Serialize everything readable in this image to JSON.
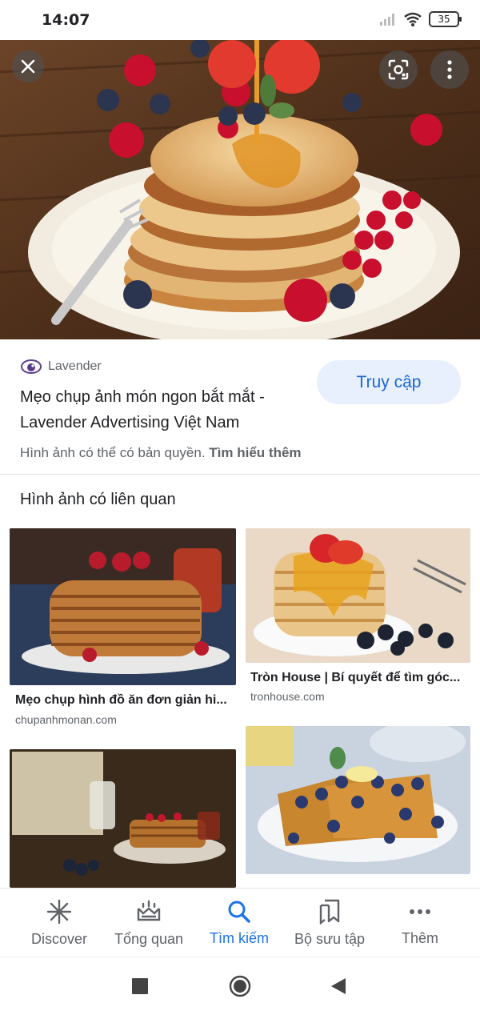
{
  "status_bar": {
    "time": "14:07",
    "battery": "35"
  },
  "hero": {
    "close_icon": "close-icon",
    "lens_icon": "lens-icon",
    "more_icon": "more-vert-icon"
  },
  "result": {
    "source": "Lavender",
    "title": "Mẹo chụp ảnh món ngon bắt mắt - Lavender Advertising Việt Nam",
    "visit_label": "Truy cập",
    "copyright_text": "Hình ảnh có thể có bản quyền.",
    "learn_more": "Tìm hiểu thêm"
  },
  "related": {
    "heading": "Hình ảnh có liên quan",
    "items": [
      {
        "caption": "Mẹo chụp hình đồ ăn đơn giản hi...",
        "domain": "chupanhmonan.com"
      },
      {
        "caption": "Tròn House | Bí quyết để tìm góc...",
        "domain": "tronhouse.com"
      },
      {
        "caption": "",
        "domain": ""
      },
      {
        "caption": "",
        "domain": ""
      }
    ]
  },
  "bottom_nav": {
    "items": [
      {
        "label": "Discover",
        "icon": "asterisk-icon"
      },
      {
        "label": "Tổng quan",
        "icon": "snapshot-icon"
      },
      {
        "label": "Tìm kiếm",
        "icon": "search-icon"
      },
      {
        "label": "Bộ sưu tập",
        "icon": "collections-icon"
      },
      {
        "label": "Thêm",
        "icon": "more-horiz-icon"
      }
    ],
    "active_color": "#1a73e8"
  },
  "system_nav": {
    "icons": [
      "recents-icon",
      "home-icon",
      "back-icon"
    ]
  }
}
